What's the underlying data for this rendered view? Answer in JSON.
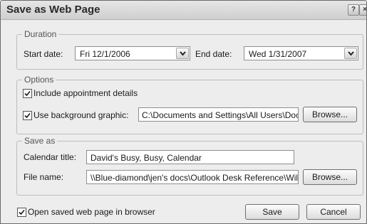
{
  "window": {
    "title": "Save as Web Page",
    "help_label": "?",
    "close_label": "×"
  },
  "duration": {
    "legend": "Duration",
    "start_label": "Start date:",
    "start_value": "Fri 12/1/2006",
    "end_label": "End date:",
    "end_value": "Wed 1/31/2007"
  },
  "options": {
    "legend": "Options",
    "include_details_label": "Include appointment details",
    "include_details_checked": true,
    "use_background_label": "Use background graphic:",
    "use_background_checked": true,
    "background_path": "C:\\Documents and Settings\\All Users\\Doc",
    "browse_label": "Browse..."
  },
  "save_as": {
    "legend": "Save as",
    "calendar_title_label": "Calendar title:",
    "calendar_title_value": "David's Busy, Busy, Calendar",
    "file_name_label": "File name:",
    "file_name_value": "\\\\Blue-diamond\\jen's docs\\Outlook Desk Reference\\Wile",
    "browse_label": "Browse..."
  },
  "footer": {
    "open_in_browser_label": "Open saved web page in browser",
    "open_in_browser_checked": true,
    "save_label": "Save",
    "cancel_label": "Cancel"
  }
}
